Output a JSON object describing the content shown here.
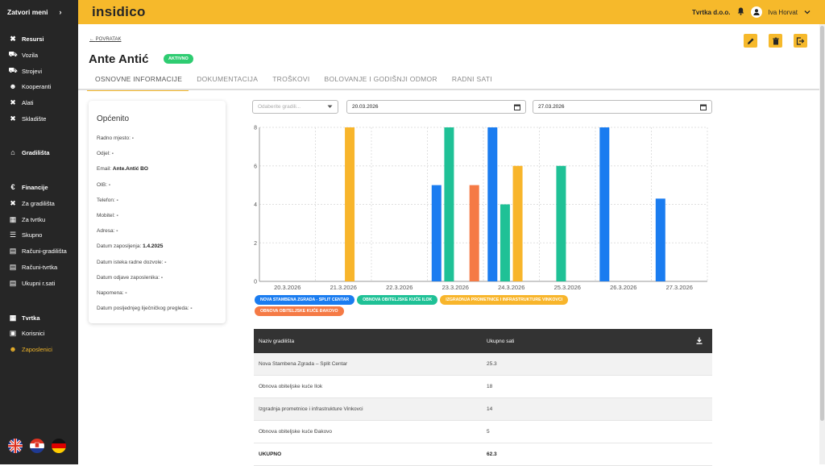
{
  "sidebar": {
    "toggle_label": "Zatvori meni",
    "items": [
      {
        "label": "Resursi",
        "icon": "tools-icon",
        "head": true
      },
      {
        "label": "Vozila",
        "icon": "car-icon"
      },
      {
        "label": "Strojevi",
        "icon": "truck-icon"
      },
      {
        "label": "Kooperanti",
        "icon": "people-icon"
      },
      {
        "label": "Alati",
        "icon": "tools-icon"
      },
      {
        "label": "Skladište",
        "icon": "tools-icon"
      },
      {
        "label": "Gradilišta",
        "icon": "building-icon",
        "head": true
      },
      {
        "label": "Financije",
        "icon": "euro-icon",
        "head": true
      },
      {
        "label": "Za gradilišta",
        "icon": "tools-icon"
      },
      {
        "label": "Za tvrtku",
        "icon": "company-icon"
      },
      {
        "label": "Skupno",
        "icon": "filter-icon"
      },
      {
        "label": "Računi-gradilišta",
        "icon": "document-icon"
      },
      {
        "label": "Računi-tvrtka",
        "icon": "document-icon"
      },
      {
        "label": "Ukupni r.sati",
        "icon": "document-icon"
      },
      {
        "label": "Tvrtka",
        "icon": "company-icon",
        "head": true
      },
      {
        "label": "Korisnici",
        "icon": "id-card-icon"
      },
      {
        "label": "Zaposlenici",
        "icon": "employees-icon",
        "active": true
      }
    ],
    "flags": [
      "uk-flag-icon",
      "croatia-flag-icon",
      "germany-flag-icon"
    ]
  },
  "topbar": {
    "logo": "insidico",
    "company": "Tvrtka d.o.o.",
    "user": "Iva Horvat"
  },
  "page": {
    "back_label": "POVRATAK",
    "name": "Ante Antić",
    "status": "AKTIVNO"
  },
  "tabs": [
    "OSNOVNE INFORMACIJE",
    "DOKUMENTACIJA",
    "TROŠKOVI",
    "BOLOVANJE I GODIŠNJI ODMOR",
    "RADNI SATI"
  ],
  "info": {
    "title": "Općenito",
    "fields": [
      {
        "label": "Radno mjesto:",
        "value": "-"
      },
      {
        "label": "Odjel:",
        "value": "-"
      },
      {
        "label": "Email:",
        "value": "Ante.Antić BO"
      },
      {
        "label": "OIB:",
        "value": "-"
      },
      {
        "label": "Telefon:",
        "value": "-"
      },
      {
        "label": "Mobitel:",
        "value": "-"
      },
      {
        "label": "Adresa:",
        "value": "-"
      },
      {
        "label": "Datum zaposljenja:",
        "value": "1.4.2025"
      },
      {
        "label": "Datum isteka radne dozvole:",
        "value": "-"
      },
      {
        "label": "Datum odjave zaposlenika:",
        "value": "-"
      },
      {
        "label": "Napomena:",
        "value": "-"
      },
      {
        "label": "Datum posljednjeg liječničkog pregleda:",
        "value": "-"
      }
    ]
  },
  "filters": {
    "site_placeholder": "Odaberite gradili...",
    "date_from": "20.03.2026",
    "date_to": "27.03.2026"
  },
  "chart_data": {
    "type": "bar",
    "categories": [
      "20.3.2026",
      "21.3.2026",
      "22.3.2026",
      "23.3.2026",
      "24.3.2026",
      "25.3.2026",
      "26.3.2026",
      "27.3.2026"
    ],
    "ylim": [
      0,
      8
    ],
    "yticks": [
      0,
      2,
      4,
      6,
      8
    ],
    "grid": true,
    "series": [
      {
        "name": "NOVA STAMBENA ZGRADA - SPLIT CENTAR",
        "color": "#1a7cf0",
        "values": [
          0,
          0,
          0,
          5,
          8,
          0,
          8,
          4.3
        ]
      },
      {
        "name": "OBNOVA OBITELJSKE KUĆE ILOK",
        "color": "#1fc196",
        "values": [
          0,
          0,
          0,
          8,
          4,
          6,
          0,
          0
        ]
      },
      {
        "name": "IZGRADNJA PROMETNICE I INFRASTRUKTURE VINKOVCI",
        "color": "#f8b52b",
        "values": [
          0,
          8,
          0,
          0,
          6,
          0,
          0,
          0
        ]
      },
      {
        "name": "OBNOVA OBITELJSKE KUĆE ĐAKOVO",
        "color": "#f57a45",
        "values": [
          0,
          0,
          0,
          5,
          0,
          0,
          0,
          0
        ]
      }
    ]
  },
  "table": {
    "headers": [
      "Naziv gradilišta",
      "Ukupno sati"
    ],
    "rows": [
      [
        "Nova Stambena Zgrada – Split Centar",
        "25.3"
      ],
      [
        "Obnova obiteljske kuće Ilok",
        "18"
      ],
      [
        "Izgradnja prometnice i infrastrukture Vinkovci",
        "14"
      ],
      [
        "Obnova obiteljske kuće Đakovo",
        "5"
      ]
    ],
    "total_label": "UKUPNO",
    "total_value": "62.3"
  }
}
